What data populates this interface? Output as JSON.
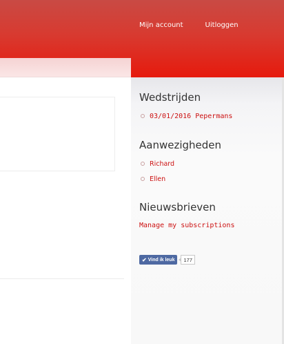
{
  "topnav": {
    "account_label": "Mijn account",
    "logout_label": "Uitloggen"
  },
  "sidebar": {
    "competitions": {
      "title": "Wedstrijden",
      "items": [
        {
          "label": "03/01/2016 Pepermans"
        }
      ]
    },
    "attendance": {
      "title": "Aanwezigheden",
      "items": [
        {
          "label": "Richard"
        },
        {
          "label": "Ellen"
        }
      ]
    },
    "newsletters": {
      "title": "Nieuwsbrieven",
      "manage_label": "Manage my subscriptions"
    },
    "facebook": {
      "like_label": "Vind ik leuk",
      "like_count": "177",
      "brand_color": "#4e69a2"
    }
  },
  "colors": {
    "header_red": "#e61a0d",
    "link_red": "#cc1111"
  },
  "icons": {
    "bullet": "circle-bullet-icon",
    "like": "checkmark-icon"
  }
}
